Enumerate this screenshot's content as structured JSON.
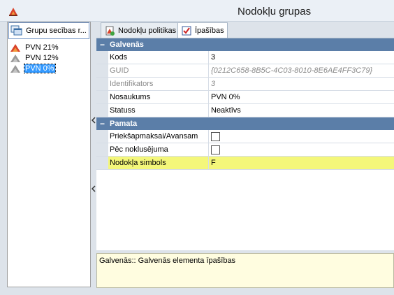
{
  "window": {
    "title": "Nodokļu grupas",
    "icon": "app-logo-icon"
  },
  "left_panel": {
    "tab_label": "Grupu secības r...",
    "tab_icon": "window-stack-icon",
    "tree": [
      {
        "label": "PVN 21%",
        "icon": "tax-item-icon",
        "selected": false
      },
      {
        "label": "PVN 12%",
        "icon": "tax-item-icon",
        "selected": false
      },
      {
        "label": "PVN 0%",
        "icon": "tax-item-icon",
        "selected": true
      }
    ]
  },
  "tabs": [
    {
      "label": "Nodokļu politikas",
      "icon": "policy-icon",
      "active": false
    },
    {
      "label": "Īpašības",
      "icon": "properties-icon",
      "active": true
    }
  ],
  "property_grid": {
    "sections": [
      {
        "name": "Galvenās",
        "expanded_symbol": "−",
        "rows": [
          {
            "name": "Kods",
            "value": "3",
            "readonly": false
          },
          {
            "name": "GUID",
            "value": "{0212C658-8B5C-4C03-8010-8E6AE4FF3C79}",
            "readonly": true
          },
          {
            "name": "Identifikators",
            "value": "3",
            "readonly": true
          },
          {
            "name": "Nosaukums",
            "value": "PVN 0%",
            "readonly": false
          },
          {
            "name": "Statuss",
            "value": "Neaktīvs",
            "readonly": false
          }
        ]
      },
      {
        "name": "Pamata",
        "expanded_symbol": "−",
        "rows": [
          {
            "name": "Priekšapmaksai/Avansam",
            "type": "checkbox",
            "checked": false
          },
          {
            "name": "Pēc noklusējuma",
            "type": "checkbox",
            "checked": false
          },
          {
            "name": "Nodokļa simbols",
            "value": "F",
            "highlighted": true
          }
        ]
      }
    ]
  },
  "description": "Galvenās:: Galvenās elementa īpašības",
  "colors": {
    "section_header": "#5b7ea8",
    "highlight": "#f4f77a",
    "selection": "#3399ff"
  }
}
